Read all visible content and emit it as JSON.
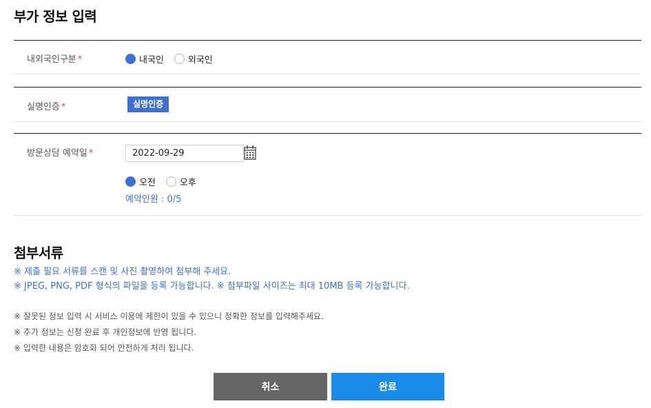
{
  "page": {
    "title": "부가 정보 입력"
  },
  "nationality": {
    "label": "내외국인구분",
    "required_mark": "*",
    "options": [
      {
        "label": "내국인",
        "selected": true
      },
      {
        "label": "외국인",
        "selected": false
      }
    ]
  },
  "verification": {
    "label": "실명인증",
    "required_mark": "*",
    "button_label": "실명인증"
  },
  "visit": {
    "label": "방문상담 예약일",
    "required_mark": "*",
    "date_value": "2022-09-29",
    "time_options": [
      {
        "label": "오전",
        "selected": true
      },
      {
        "label": "오후",
        "selected": false
      }
    ],
    "booking_count": "예약인원 : 0/5"
  },
  "attachments": {
    "title": "첨부서류",
    "notes_blue": [
      "※ 제출 필요 서류를 스캔 및 사진 촬영하여 첨부해 주세요.",
      "※ JPEG, PNG, PDF 형식의 파일을 등록 가능합니다. ※ 첨부파일 사이즈는 최대 10MB 등록 가능합니다."
    ],
    "notes_gray": [
      "※ 잘못된 정보 입력 시 서비스 이용에 제한이 있을 수 있으니 정확한 정보를 입력해주세요.",
      "※ 추가 정보는 신청 완료 후 개인정보에 반영 됩니다.",
      "※ 입력한 내용은 암호화 되어 안전하게 처리 됩니다."
    ]
  },
  "actions": {
    "cancel_label": "취소",
    "confirm_label": "완료"
  },
  "colors": {
    "accent": "#3f6fd1",
    "primary_button": "#1a8be8",
    "secondary_button": "#666666",
    "required": "#e04646"
  },
  "icons": {
    "calendar": "calendar-icon"
  }
}
